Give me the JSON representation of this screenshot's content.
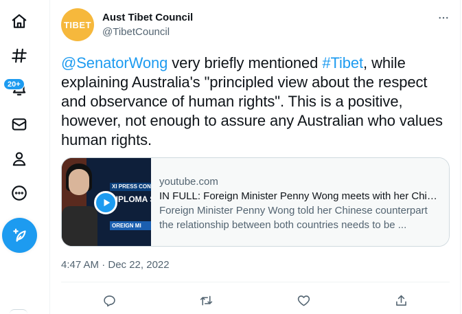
{
  "nav": {
    "items": [
      {
        "icon": "home-icon"
      },
      {
        "icon": "explore-hashtag-icon"
      },
      {
        "icon": "notifications-bell-icon",
        "badge": "20+"
      },
      {
        "icon": "messages-envelope-icon"
      },
      {
        "icon": "profile-icon"
      },
      {
        "icon": "more-circle-icon"
      }
    ],
    "compose_icon": "compose-feather-icon"
  },
  "tweet": {
    "author": {
      "name": "Aust Tibet Council",
      "handle": "@TibetCouncil",
      "avatar_text": "TIBET",
      "avatar_color": "#f6b83c"
    },
    "text": {
      "mention": "@SenatorWong",
      "part1": " very briefly mentioned ",
      "hashtag": "#Tibet",
      "part2": ", while explaining Australia's \"principled view about the respect and observance of human rights\". This is a positive, however, not enough to assure any Australian who values human rights."
    },
    "card": {
      "domain": "youtube.com",
      "title": "IN FULL: Foreign Minister Penny Wong meets with her Chin...",
      "description": "Foreign Minister Penny Wong told her Chinese counterpart the relationship between both countries needs to be ...",
      "thumbnail": {
        "band_text": "XI PRESS CON",
        "headline": "DIPLOMA SIT",
        "sub_text": "OREIGN MI"
      }
    },
    "timestamp": "4:47 AM · Dec 22, 2022",
    "actions": [
      "reply-icon",
      "retweet-icon",
      "like-icon",
      "share-icon"
    ]
  },
  "colors": {
    "accent": "#1d9bf0",
    "text_primary": "#0f1419",
    "text_secondary": "#536471",
    "border": "#cfd9de"
  }
}
